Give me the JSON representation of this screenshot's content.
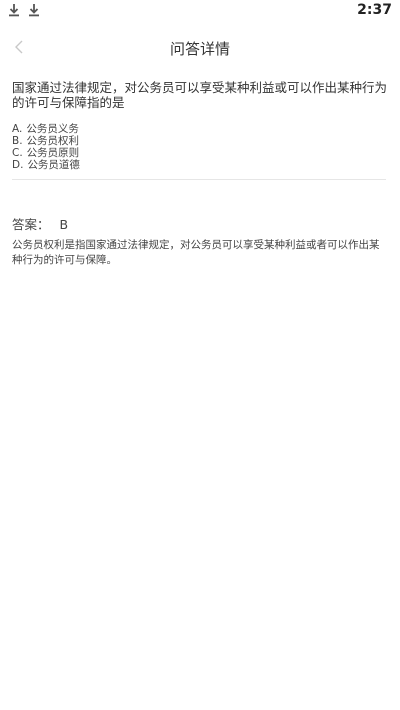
{
  "status_bar": {
    "time": "2:37",
    "icons": [
      "download-icon",
      "download-icon"
    ]
  },
  "header": {
    "title": "问答详情",
    "back_icon": "chevron-left-icon"
  },
  "question": {
    "text": "国家通过法律规定，对公务员可以享受某种利益或可以作出某种行为的许可与保障指的是",
    "options": [
      {
        "letter": "A.",
        "text": "公务员义务"
      },
      {
        "letter": "B.",
        "text": "公务员权利"
      },
      {
        "letter": "C.",
        "text": "公务员原则"
      },
      {
        "letter": "D.",
        "text": "公务员道德"
      }
    ]
  },
  "answer": {
    "label": "答案：",
    "value": "B",
    "explanation": "公务员权利是指国家通过法律规定，对公务员可以享受某种利益或者可以作出某种行为的许可与保障。"
  }
}
